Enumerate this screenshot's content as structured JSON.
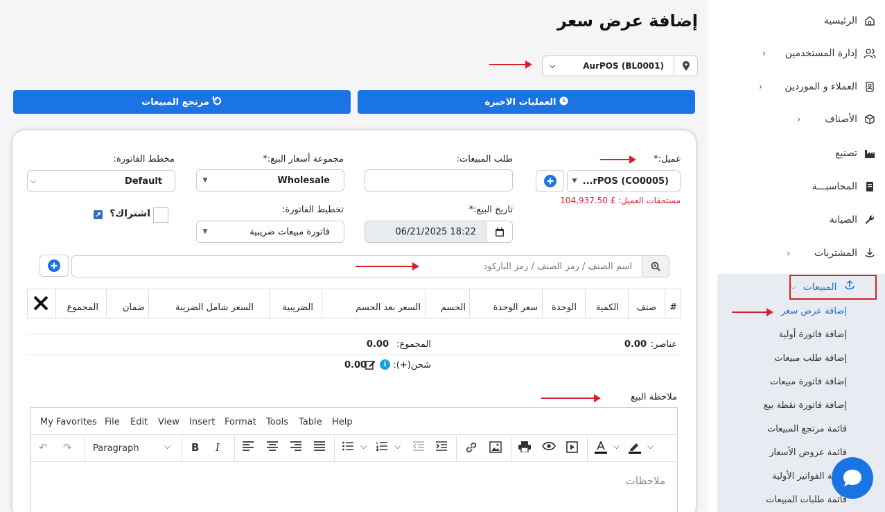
{
  "page": {
    "title": "إضافة عرض سعر"
  },
  "location": {
    "value": "AurPOS (BL0001)"
  },
  "buttons": {
    "recent": "العمليات الاخيرة",
    "returns": "مرتجع المبيعات"
  },
  "form": {
    "customer_label": "عميل:*",
    "customer_value": "...rPOS (CO0005)",
    "customer_due": "مستحقات العميل: £ 104,937.50",
    "sales_order_label": "طلب المبيعات:",
    "price_group_label": "مجموعة أسعار البيع:*",
    "price_group_value": "Wholesale",
    "invoice_scheme_label": "مخطط الفاتورة:",
    "invoice_scheme_value": "Default",
    "sale_date_label": "تاريخ البيع:*",
    "sale_date_value": "06/21/2025 18:22",
    "invoice_layout_label": "تخطيط الفاتورة:",
    "invoice_layout_value": "فاتورة مبيعات ضريبية",
    "subscription_label": "اشتراك؟"
  },
  "search": {
    "placeholder": "اسم الصنف / رمز الصنف / رمز الباركود"
  },
  "table": {
    "headers": [
      "#",
      "صنف",
      "الكمية",
      "الوحدة",
      "سعر الوحدة",
      "الحسم",
      "السعر بعد الحسم",
      "الضريبية",
      "السعر شامل الضريبة",
      "ضمان",
      "المجموع"
    ]
  },
  "totals": {
    "items_label": "عناصر:",
    "items_value": "0.00",
    "total_label": "المجموع:",
    "total_value": "0.00",
    "shipping_label": "شحن(+):",
    "shipping_value": "0.00"
  },
  "note": {
    "label": "ملاحظة البيع",
    "menu": [
      "My Favorites",
      "File",
      "Edit",
      "View",
      "Insert",
      "Format",
      "Tools",
      "Table",
      "Help"
    ],
    "paragraph": "Paragraph",
    "placeholder": "ملاحظات"
  },
  "sidebar": {
    "items": [
      {
        "label": "الرئيسية"
      },
      {
        "label": "إدارة المستخدمين"
      },
      {
        "label": "العملاء و الموردين"
      },
      {
        "label": "الأصناف"
      },
      {
        "label": "تصنيع"
      },
      {
        "label": "المحاسبـــة"
      },
      {
        "label": "الصيانة"
      },
      {
        "label": "المشتريات"
      },
      {
        "label": "المبيعات"
      }
    ],
    "sub_items": [
      {
        "label": "إضافة عرض سعر"
      },
      {
        "label": "إضافة فاتورة أولية"
      },
      {
        "label": "إضافة طلب مبيعات"
      },
      {
        "label": "إضافة فاتورة مبيعات"
      },
      {
        "label": "إضافة فاتورة نقطة بيع"
      },
      {
        "label": "قائمة مرتجع المبيعات"
      },
      {
        "label": "قائمة عروض الأسعار"
      },
      {
        "label": "قائمة الفواتير الأولية"
      },
      {
        "label": "قائمة طلبات المبيعات"
      }
    ]
  },
  "colors": {
    "primary": "#1b74e4",
    "highlight": "#d7202a",
    "active_text": "#1e6fd9"
  }
}
